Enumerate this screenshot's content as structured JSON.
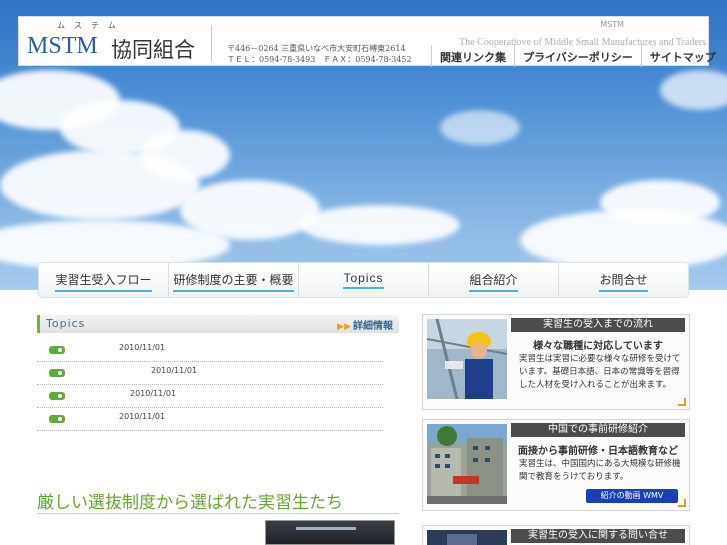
{
  "header": {
    "logo_kana": "ムステム",
    "logo_main": "MSTM",
    "logo_sub": "協同組合",
    "address_line": "〒446－0264 三重県いなべ市大安町石榑東2614",
    "contact_line": "ＴＥＬ：0594-78-3493　ＦＡＸ：0594-78-3452",
    "tag_mstm": "MSTM",
    "tagline": "The Cooperatiove of Middle Small Manufactures and Traders",
    "nav": [
      "関連リンク集",
      "プライバシーポリシー",
      "サイトマップ"
    ]
  },
  "global_nav": [
    "実習生受入フロー",
    "研修制度の主要・概要",
    "Topics",
    "組合紹介",
    "お問合せ"
  ],
  "topics": {
    "title": "Topics",
    "detail_link": "詳細情報",
    "items": [
      {
        "date": "2010/11/01"
      },
      {
        "date": "2010/11/01"
      },
      {
        "date": "2010/11/01"
      },
      {
        "date": "2010/11/01"
      }
    ]
  },
  "section": {
    "title": "厳しい選抜制度から選ばれた実習生たち"
  },
  "cards": [
    {
      "header": "実習生の受入までの流れ",
      "subtitle": "様々な職種に対応しています",
      "body": "実習生は実習に必要な様々な研修を受けています。基礎日本語、日本の常識等を習得した人材を受け入れることが出来ます。"
    },
    {
      "header": "中国での事前研修紹介",
      "subtitle": "面接から事前研修・日本語教育など",
      "body": "実習生は、中国国内にある大規模な研修機関で教育をうけております。",
      "button": "紹介の動画 WMV"
    },
    {
      "header": "実習生の受入に関する問い合せ"
    }
  ],
  "colors": {
    "accent_green": "#64a630",
    "link_blue": "#2a5e9e",
    "card_header_bg": "#4c4c4c",
    "corner_orange": "#e89a22"
  }
}
